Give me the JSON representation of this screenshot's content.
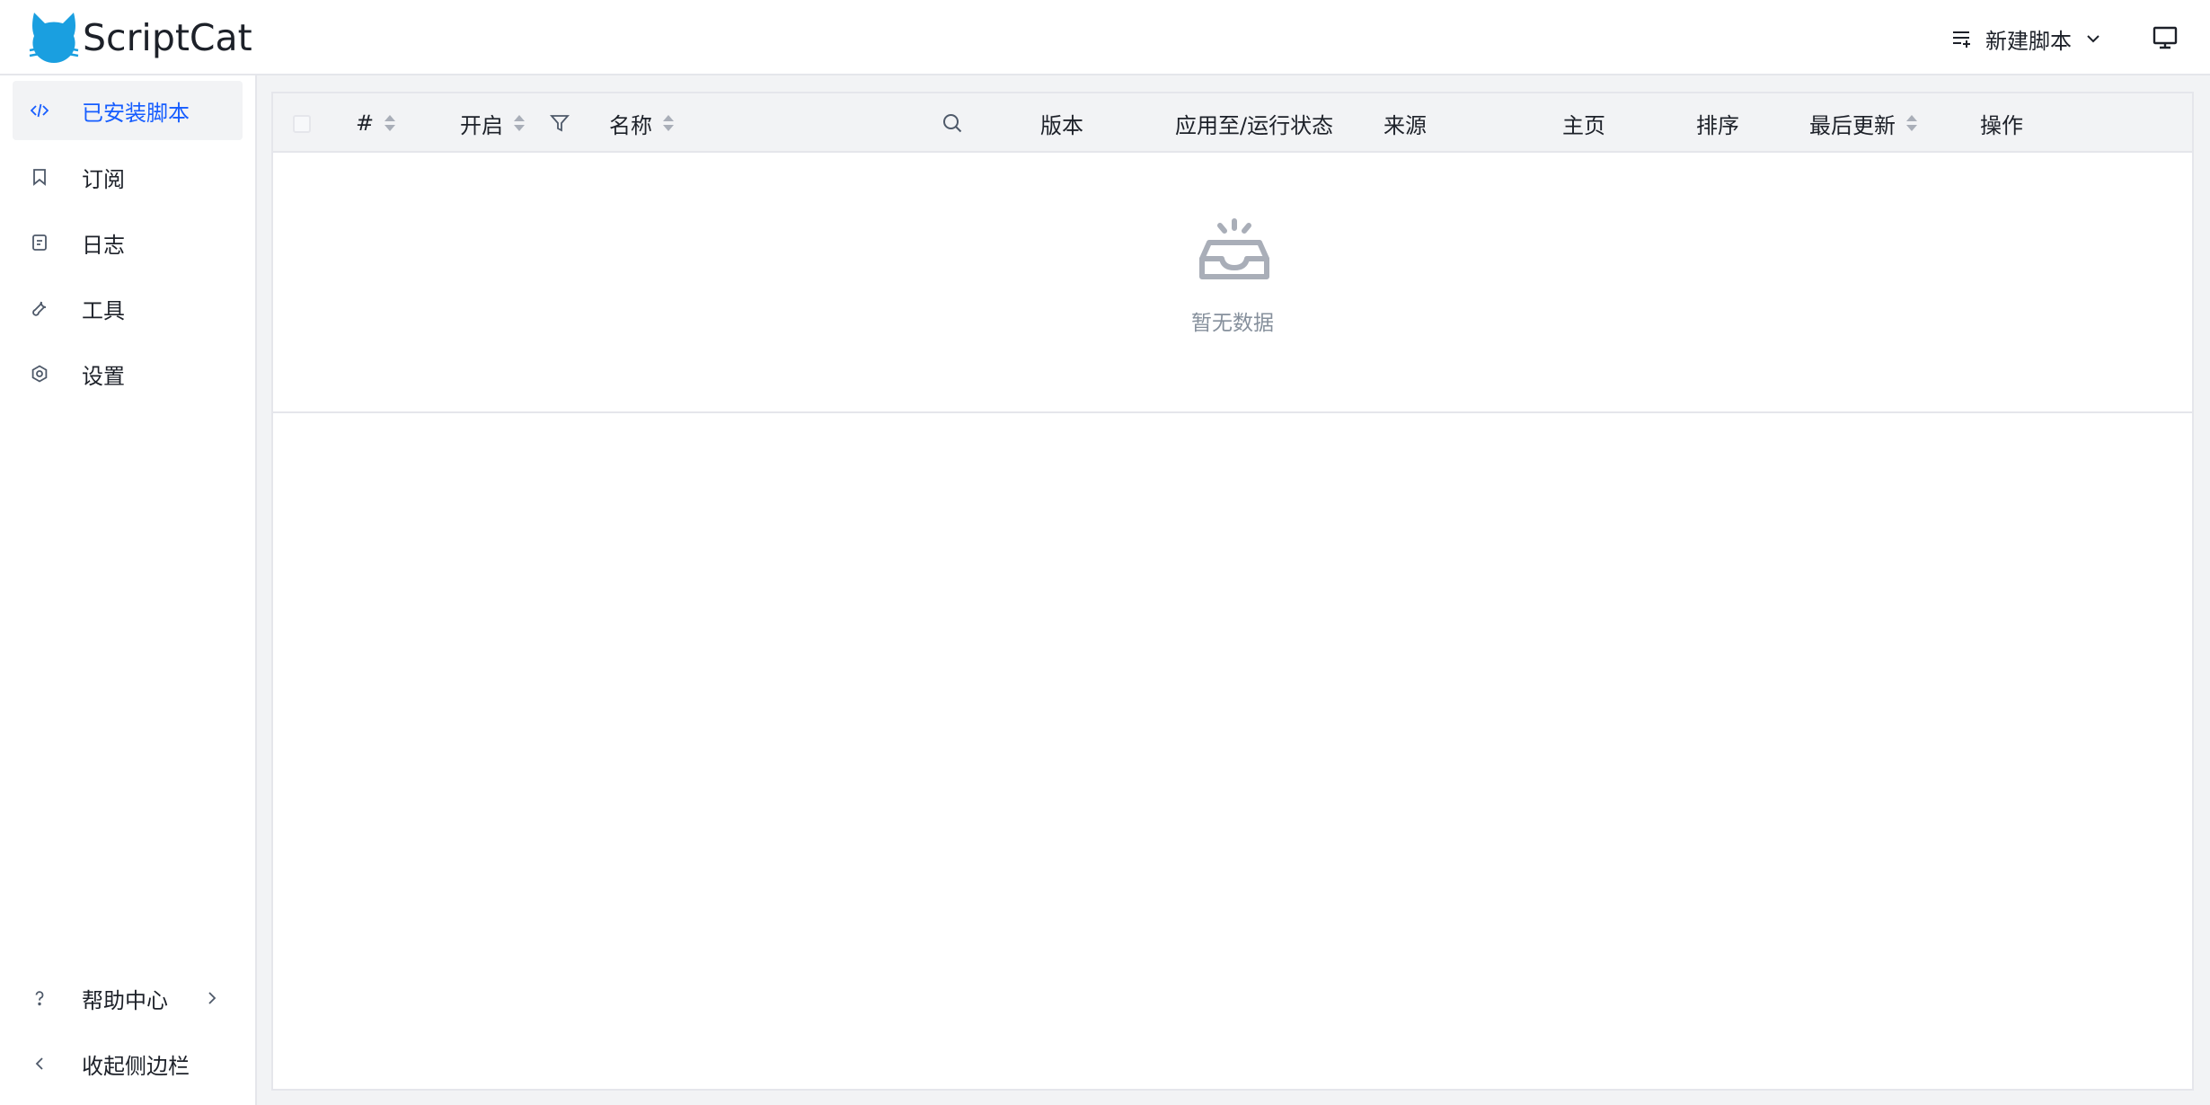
{
  "app": {
    "title": "ScriptCat"
  },
  "header": {
    "new_script_label": "新建脚本",
    "icons": [
      "cat-logo",
      "list-add-icon",
      "chevron-down-icon",
      "monitor-icon"
    ]
  },
  "sidebar": {
    "items": [
      {
        "label": "已安装脚本",
        "icon": "code-icon",
        "active": true
      },
      {
        "label": "订阅",
        "icon": "bookmark-icon",
        "active": false
      },
      {
        "label": "日志",
        "icon": "file-icon",
        "active": false
      },
      {
        "label": "工具",
        "icon": "wrench-icon",
        "active": false
      },
      {
        "label": "设置",
        "icon": "gear-icon",
        "active": false
      }
    ],
    "bottom": [
      {
        "label": "帮助中心",
        "icon": "question-icon"
      },
      {
        "label": "收起侧边栏",
        "icon": "chevron-left-icon"
      }
    ]
  },
  "table": {
    "columns": {
      "index": "#",
      "enabled": "开启",
      "name": "名称",
      "version": "版本",
      "apply_status": "应用至/运行状态",
      "source": "来源",
      "homepage": "主页",
      "order": "排序",
      "updated": "最后更新",
      "actions": "操作"
    },
    "empty_text": "暂无数据"
  },
  "colors": {
    "accent": "#165dff",
    "text": "#1d2129",
    "muted": "#86909c",
    "logo": "#1a9fe0"
  }
}
